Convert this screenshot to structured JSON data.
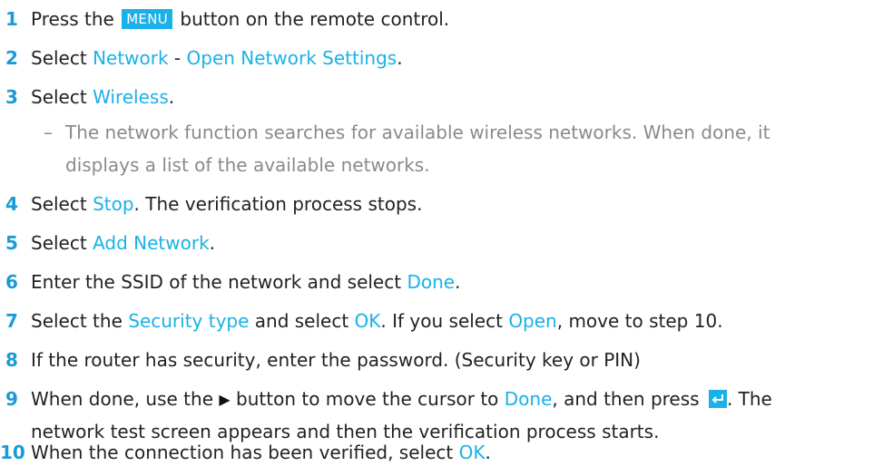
{
  "steps": [
    {
      "num": "1",
      "pre": "Press the ",
      "badge": "MENU",
      "post": " button on the remote control."
    },
    {
      "num": "2",
      "pre": "Select ",
      "hl1": "Network",
      "mid": " - ",
      "hl2": "Open Network Settings",
      "post": "."
    },
    {
      "num": "3",
      "pre": "Select ",
      "hl1": "Wireless",
      "post": "."
    },
    {
      "num": "4",
      "pre": "Select ",
      "hl1": "Stop",
      "post": ". The verification process stops."
    },
    {
      "num": "5",
      "pre": "Select ",
      "hl1": "Add Network",
      "post": "."
    },
    {
      "num": "6",
      "pre": "Enter the SSID of the network and select ",
      "hl1": "Done",
      "post": "."
    },
    {
      "num": "7",
      "pre": "Select the ",
      "hl1": "Security type",
      "mid1": " and select ",
      "hl2": "OK",
      "mid2": ". If you select ",
      "hl3": "Open",
      "mid3": ", move to step ",
      "step_ref": "10",
      "post": "."
    },
    {
      "num": "8",
      "text": "If the router has security, enter the password. (Security key or PIN)"
    },
    {
      "num": "9",
      "pre": "When done, use the ",
      "arrow": "▶",
      "mid": " button to move the cursor to ",
      "hl1": "Done",
      "mid2": ", and then press ",
      "post": ". The",
      "line2": "network test screen appears and then the verification process starts."
    },
    {
      "num": "10",
      "pre": "When the connection has been verified, select ",
      "hl1": "OK",
      "post": "."
    }
  ],
  "note": {
    "dash": "–",
    "line1": "The network function searches for available wireless networks. When done, it",
    "line2": "displays a list of the available networks."
  },
  "icons": {
    "enter": "enter-icon"
  },
  "colors": {
    "accent": "#1ab1e8",
    "number": "#1a9bd7",
    "note": "#8a8a8a"
  }
}
